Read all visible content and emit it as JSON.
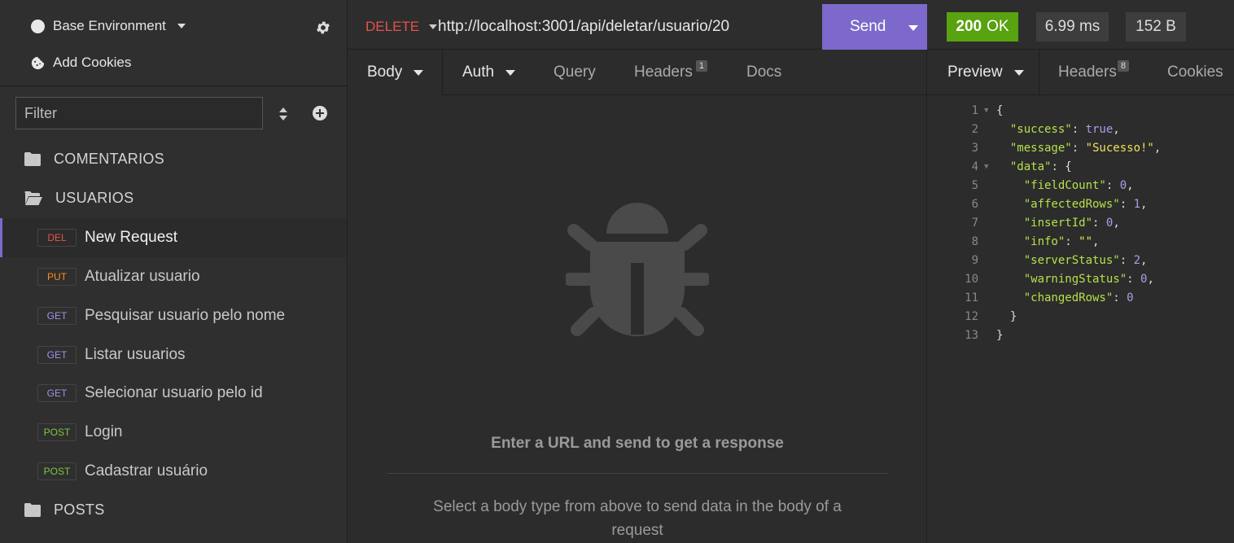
{
  "sidebar": {
    "environment": "Base Environment",
    "cookies": "Add Cookies",
    "filter_placeholder": "Filter",
    "folders": [
      "COMENTARIOS",
      "USUARIOS",
      "POSTS"
    ],
    "requests": [
      {
        "method": "DEL",
        "name": "New Request",
        "color": "#e5534b"
      },
      {
        "method": "PUT",
        "name": "Atualizar usuario",
        "color": "#ff8c1a"
      },
      {
        "method": "GET",
        "name": "Pesquisar usuario pelo nome",
        "color": "#a48ee8"
      },
      {
        "method": "GET",
        "name": "Listar usuarios",
        "color": "#a48ee8"
      },
      {
        "method": "GET",
        "name": "Selecionar usuario pelo id",
        "color": "#a48ee8"
      },
      {
        "method": "POST",
        "name": "Login",
        "color": "#7ec73a"
      },
      {
        "method": "POST",
        "name": "Cadastrar usuário",
        "color": "#7ec73a"
      }
    ]
  },
  "request": {
    "method": "DELETE",
    "url": "http://localhost:3001/api/deletar/usuario/20",
    "send_label": "Send",
    "tabs": {
      "body": "Body",
      "auth": "Auth",
      "query": "Query",
      "headers": "Headers",
      "headers_count": "1",
      "docs": "Docs"
    },
    "empty_title": "Enter a URL and send to get a response",
    "empty_sub": "Select a body type from above to send data in the body of a request"
  },
  "response": {
    "status_code": "200",
    "status_text": "OK",
    "time": "6.99 ms",
    "size": "152 B",
    "tabs": {
      "preview": "Preview",
      "headers": "Headers",
      "headers_count": "8",
      "cookies": "Cookies"
    },
    "lines": [
      "{",
      "  \"success\": true,",
      "  \"message\": \"Sucesso!\",",
      "  \"data\": {",
      "    \"fieldCount\": 0,",
      "    \"affectedRows\": 1,",
      "    \"insertId\": 0,",
      "    \"info\": \"\",",
      "    \"serverStatus\": 2,",
      "    \"warningStatus\": 0,",
      "    \"changedRows\": 0",
      "  }",
      "}"
    ]
  },
  "icons": [
    "circle-icon",
    "gear-icon",
    "cookie-icon",
    "sort-icon",
    "plus-circle-icon",
    "folder-icon",
    "folder-open-icon",
    "bug-icon",
    "chevron-down-icon"
  ]
}
